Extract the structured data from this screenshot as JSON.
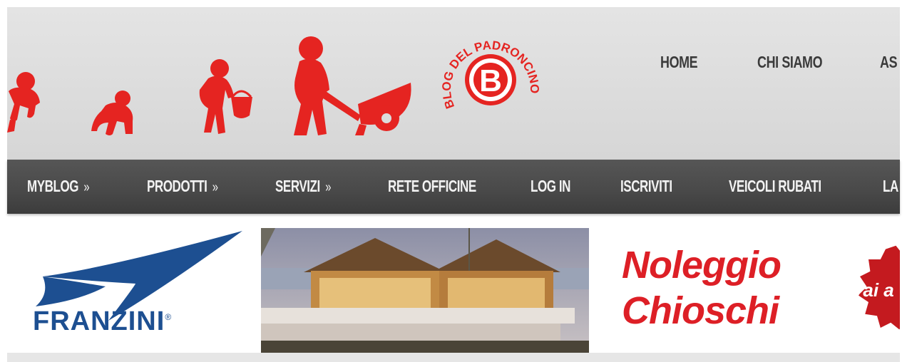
{
  "colors": {
    "brand_red": "#e52421",
    "header_bg": "#dcdcdc",
    "nav_bg": "#4a4a4a",
    "franzini_blue": "#1d4f91",
    "noleggio_red": "#dd1f26"
  },
  "header": {
    "evolution_figures": [
      "crawling-figure-icon",
      "kneeling-figure-icon",
      "figure-carrying-bucket-icon",
      "figure-pushing-wheelbarrow-icon"
    ],
    "logo": {
      "text": "BLOG DEL PADRONCINO",
      "letter": "B"
    },
    "top_nav": [
      "HOME",
      "CHI SIAMO",
      "AS"
    ]
  },
  "main_nav": {
    "items": [
      {
        "label": "MYBLOG",
        "has_submenu": true
      },
      {
        "label": "PRODOTTI",
        "has_submenu": true
      },
      {
        "label": "SERVIZI",
        "has_submenu": true
      },
      {
        "label": "RETE OFFICINE",
        "has_submenu": false
      },
      {
        "label": "LOG IN",
        "has_submenu": false
      },
      {
        "label": "ISCRIVITI",
        "has_submenu": false
      },
      {
        "label": "VEICOLI RUBATI",
        "has_submenu": false
      },
      {
        "label": "LA",
        "has_submenu": false
      }
    ],
    "submenu_marker": "»"
  },
  "banner": {
    "brand": "FRANZINI",
    "brand_mark": "®",
    "headline_line1": "Noleggio",
    "headline_line2": "Chioschi",
    "cta": "Vai a"
  }
}
